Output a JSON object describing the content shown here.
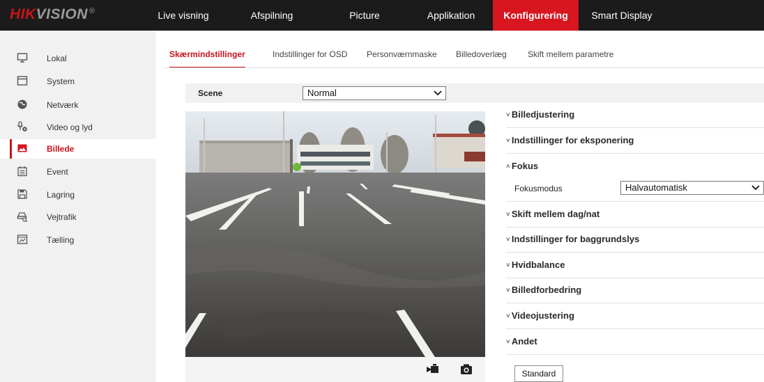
{
  "logo": {
    "brand_red": "HIK",
    "brand_gray": "VISION",
    "mark": "®"
  },
  "nav": [
    {
      "label": "Live visning"
    },
    {
      "label": "Afspilning"
    },
    {
      "label": "Picture"
    },
    {
      "label": "Applikation"
    },
    {
      "label": "Konfigurering",
      "active": true
    },
    {
      "label": "Smart Display"
    }
  ],
  "sidebar": {
    "items": [
      {
        "label": "Lokal",
        "icon": "monitor-icon"
      },
      {
        "label": "System",
        "icon": "system-window-icon"
      },
      {
        "label": "Netværk",
        "icon": "globe-icon"
      },
      {
        "label": "Video og lyd",
        "icon": "microphone-icon"
      },
      {
        "label": "Billede",
        "icon": "image-icon",
        "active": true
      },
      {
        "label": "Event",
        "icon": "calendar-icon"
      },
      {
        "label": "Lagring",
        "icon": "storage-disk-icon"
      },
      {
        "label": "Vejtrafik",
        "icon": "traffic-car-icon"
      },
      {
        "label": "Tælling",
        "icon": "counting-chart-icon"
      }
    ]
  },
  "tabs": [
    {
      "label": "Skærmindstillinger",
      "active": true
    },
    {
      "label": "Indstillinger for OSD"
    },
    {
      "label": "Personværnmaske"
    },
    {
      "label": "Billedoverlæg"
    },
    {
      "label": "Skift mellem parametre"
    }
  ],
  "scene": {
    "label": "Scene",
    "value": "Normal"
  },
  "video_toolbar": {
    "record_icon": "record-video-icon",
    "snapshot_icon": "camera-snapshot-icon"
  },
  "panel": {
    "sections": [
      {
        "title": "Billedjustering",
        "expanded": false
      },
      {
        "title": "Indstillinger for eksponering",
        "expanded": false
      },
      {
        "title": "Fokus",
        "expanded": true
      },
      {
        "title": "Skift mellem dag/nat",
        "expanded": false
      },
      {
        "title": "Indstillinger for baggrundslys",
        "expanded": false
      },
      {
        "title": "Hvidbalance",
        "expanded": false
      },
      {
        "title": "Billedforbedring",
        "expanded": false
      },
      {
        "title": "Videojustering",
        "expanded": false
      },
      {
        "title": "Andet",
        "expanded": false
      }
    ],
    "focus": {
      "label": "Fokusmodus",
      "value": "Halvautomatisk"
    },
    "caret_collapsed": "˅",
    "caret_expanded": "˄",
    "default_button": "Standard"
  },
  "colors": {
    "accent": "#d7161f",
    "topbar": "#1b1b1b",
    "sidebar": "#f1f1f1"
  }
}
